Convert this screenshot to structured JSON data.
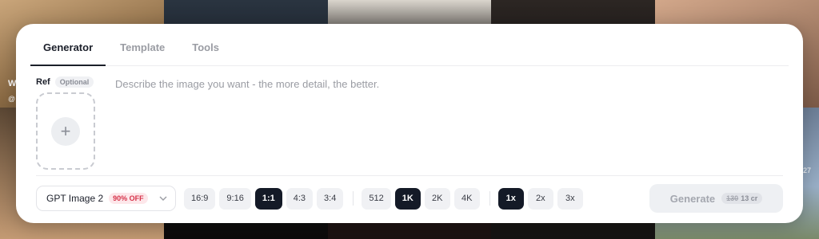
{
  "tabs": [
    {
      "label": "Generator"
    },
    {
      "label": "Template"
    },
    {
      "label": "Tools"
    }
  ],
  "ref": {
    "label": "Ref",
    "optional": "Optional"
  },
  "prompt": {
    "placeholder": "Describe the image you want - the more detail, the better."
  },
  "model": {
    "name": "GPT Image 2",
    "badge": "90% OFF"
  },
  "aspect_ratios": [
    "16:9",
    "9:16",
    "1:1",
    "4:3",
    "3:4"
  ],
  "aspect_selected": "1:1",
  "resolutions": [
    "512",
    "1K",
    "2K",
    "4K"
  ],
  "resolution_selected": "1K",
  "counts": [
    "1x",
    "2x",
    "3x"
  ],
  "count_selected": "1x",
  "generate": {
    "label": "Generate",
    "old_cost": "130",
    "cost": "13 cr"
  },
  "background": {
    "edge_text_left_1": "W",
    "edge_text_left_2": "@",
    "edge_text_right": "27"
  }
}
